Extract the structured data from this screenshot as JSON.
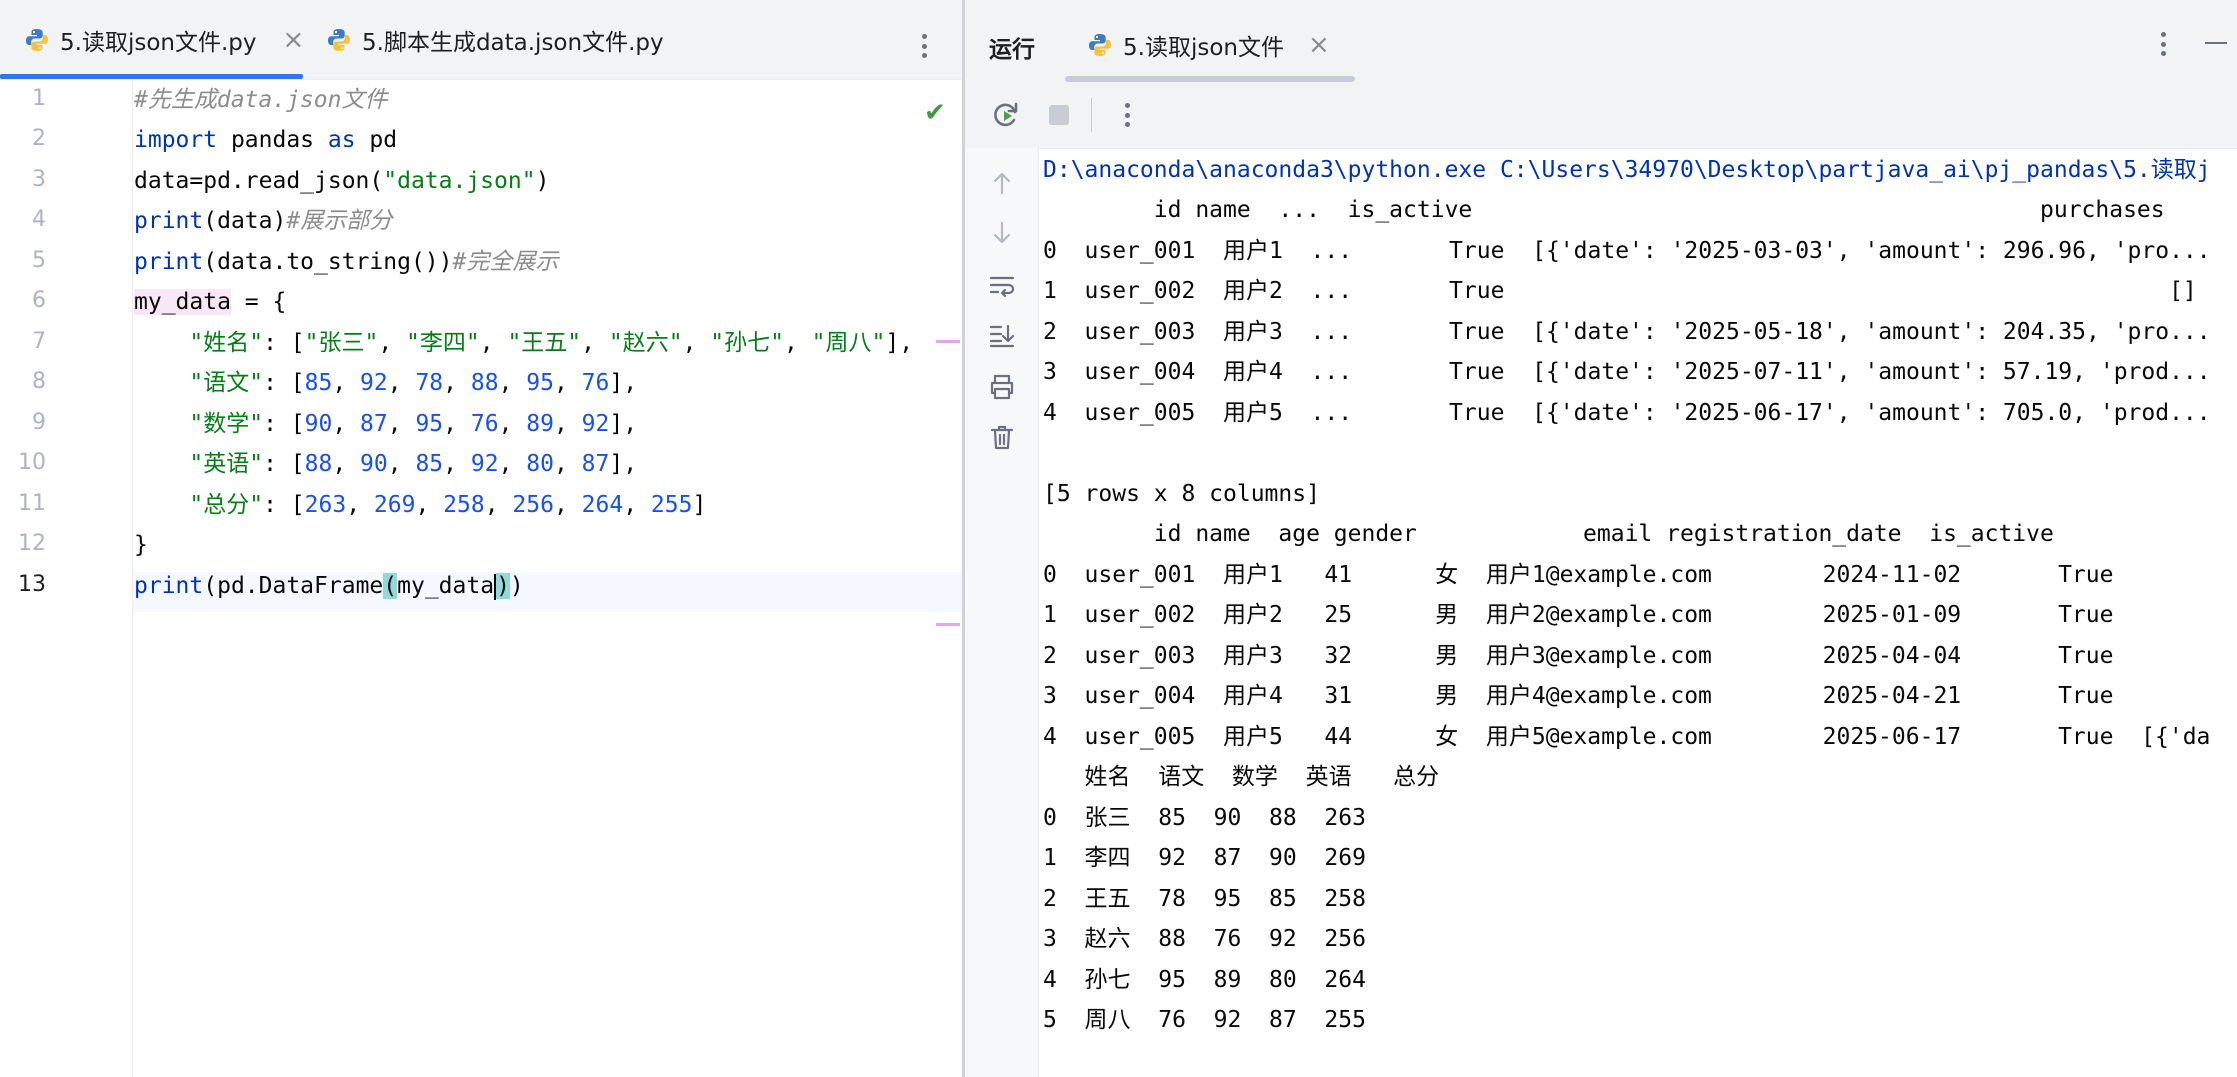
{
  "editor": {
    "tabs": [
      {
        "label": "5.读取json文件.py",
        "active": true
      },
      {
        "label": "5.脚本生成data.json文件.py",
        "active": false
      }
    ],
    "line_numbers": [
      "1",
      "2",
      "3",
      "4",
      "5",
      "6",
      "7",
      "8",
      "9",
      "10",
      "11",
      "12",
      "13"
    ],
    "code": {
      "l1_comment": "#先生成data.json文件",
      "l2_import": "import",
      "l2_mod": " pandas ",
      "l2_as": "as",
      "l2_alias": " pd",
      "l3_pre": "data=pd.read_json(",
      "l3_str": "\"data.json\"",
      "l3_post": ")",
      "l4_kw": "print",
      "l4_arg": "(data)",
      "l4_cmt": "#展示部分",
      "l5_kw": "print",
      "l5_arg": "(data.to_string())",
      "l5_cmt": "#完全展示",
      "l6_var": "my_data",
      "l6_rest": " = {",
      "l7_key": "    \"姓名\"",
      "l7_colon": ": [",
      "l7_vals": [
        "\"张三\"",
        "\"李四\"",
        "\"王五\"",
        "\"赵六\"",
        "\"孙七\"",
        "\"周八\""
      ],
      "l7_end": "],",
      "l8_key": "    \"语文\"",
      "l8_vals": [
        "85",
        "92",
        "78",
        "88",
        "95",
        "76"
      ],
      "l9_key": "    \"数学\"",
      "l9_vals": [
        "90",
        "87",
        "95",
        "76",
        "89",
        "92"
      ],
      "l10_key": "    \"英语\"",
      "l10_vals": [
        "88",
        "90",
        "85",
        "92",
        "80",
        "87"
      ],
      "l11_key": "    \"总分\"",
      "l11_vals": [
        "263",
        "269",
        "258",
        "256",
        "264",
        "255"
      ],
      "l12": "}",
      "l13_kw": "print",
      "l13_mid": "(pd.DataFrame",
      "l13_open": "(",
      "l13_arg": "my_data",
      "l13_close": ")",
      "l13_end": ")"
    }
  },
  "run": {
    "title": "运行",
    "tab_label": "5.读取json文件",
    "output": [
      "D:\\anaconda\\anaconda3\\python.exe C:\\Users\\34970\\Desktop\\partjava_ai\\pj_pandas\\5.读取j",
      "        id name  ...  is_active                                         purchases",
      "0  user_001  用户1  ...       True  [{'date': '2025-03-03', 'amount': 296.96, 'pro...",
      "1  user_002  用户2  ...       True                                                []",
      "2  user_003  用户3  ...       True  [{'date': '2025-05-18', 'amount': 204.35, 'pro...",
      "3  user_004  用户4  ...       True  [{'date': '2025-07-11', 'amount': 57.19, 'prod...",
      "4  user_005  用户5  ...       True  [{'date': '2025-06-17', 'amount': 705.0, 'prod...",
      "",
      "[5 rows x 8 columns]",
      "        id name  age gender            email registration_date  is_active",
      "0  user_001  用户1   41      女  用户1@example.com        2024-11-02       True",
      "1  user_002  用户2   25      男  用户2@example.com        2025-01-09       True",
      "2  user_003  用户3   32      男  用户3@example.com        2025-04-04       True",
      "3  user_004  用户4   31      男  用户4@example.com        2025-04-21       True",
      "4  user_005  用户5   44      女  用户5@example.com        2025-06-17       True  [{'da",
      "   姓名  语文  数学  英语   总分",
      "0  张三  85  90  88  263",
      "1  李四  92  87  90  269",
      "2  王五  78  95  85  258",
      "3  赵六  88  76  92  256",
      "4  孙七  95  89  80  264",
      "5  周八  76  92  87  255"
    ]
  },
  "icons": {
    "editor_tab": "python-file-icon",
    "tab_close": "close-icon",
    "menu": "more-vertical-icon",
    "inspection": "check-icon",
    "rerun": "rerun-icon",
    "stop": "stop-icon",
    "up": "arrow-up-icon",
    "down": "arrow-down-icon",
    "wrap": "soft-wrap-icon",
    "scroll": "scroll-to-end-icon",
    "print": "print-icon",
    "trash": "trash-icon"
  },
  "colors": {
    "keyword": "#0033b3",
    "string": "#067d17",
    "number": "#1750eb",
    "comment": "#8c8c8c",
    "accent": "#3574f0"
  }
}
